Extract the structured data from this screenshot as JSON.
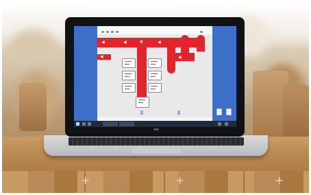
{
  "scene": {
    "subject": "laptop-on-wooden-table",
    "screen_colors": {
      "accent_red": "#e0252c",
      "side_blue": "#3e6fc8",
      "taskbar": "#1f2a3a"
    }
  },
  "app": {
    "diagram_blocks": 6,
    "icons": [
      "fan-icon",
      "filter-icon",
      "heater-icon",
      "cooler-icon",
      "sensor-icon"
    ]
  }
}
